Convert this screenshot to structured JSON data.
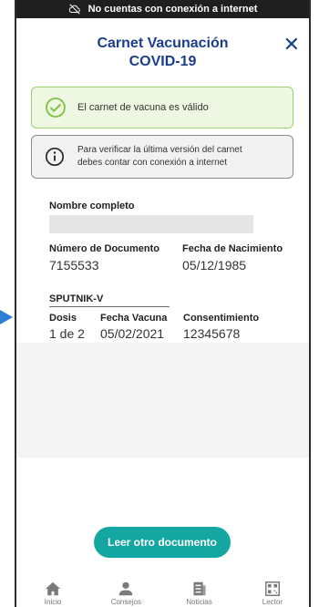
{
  "status_bar": {
    "text": "No cuentas con conexión a internet",
    "icon": "cloud-off-icon"
  },
  "header": {
    "title_line1": "Carnet Vacunación",
    "title_line2": "COVID-19"
  },
  "valid_banner": {
    "text": "El carnet de vacuna es válido",
    "icon": "check-circle-icon"
  },
  "info_banner": {
    "line1": "Para verificar la última versión del carnet",
    "line2": "debes contar con conexión a internet",
    "icon": "info-icon"
  },
  "holder": {
    "name_label": "Nombre completo",
    "document_label": "Número de Documento",
    "document_value": "7155533",
    "birth_label": "Fecha de Nacimiento",
    "birth_value": "05/12/1985"
  },
  "vaccine": {
    "name": "SPUTNIK-V",
    "dose_label": "Dosis",
    "dose_value": "1 de 2",
    "date_label": "Fecha Vacuna",
    "date_value": "05/02/2021",
    "consent_label": "Consentimiento",
    "consent_value": "12345678"
  },
  "actions": {
    "read_other": "Leer otro documento"
  },
  "nav": {
    "items": [
      {
        "label": "Inicio",
        "icon": "home-icon"
      },
      {
        "label": "Consejos",
        "icon": "person-icon"
      },
      {
        "label": "Noticias",
        "icon": "news-icon"
      },
      {
        "label": "Lector",
        "icon": "qr-icon"
      }
    ]
  },
  "colors": {
    "primary": "#1b3d8f",
    "accent": "#14a7a1",
    "valid": "#9cd26a"
  }
}
